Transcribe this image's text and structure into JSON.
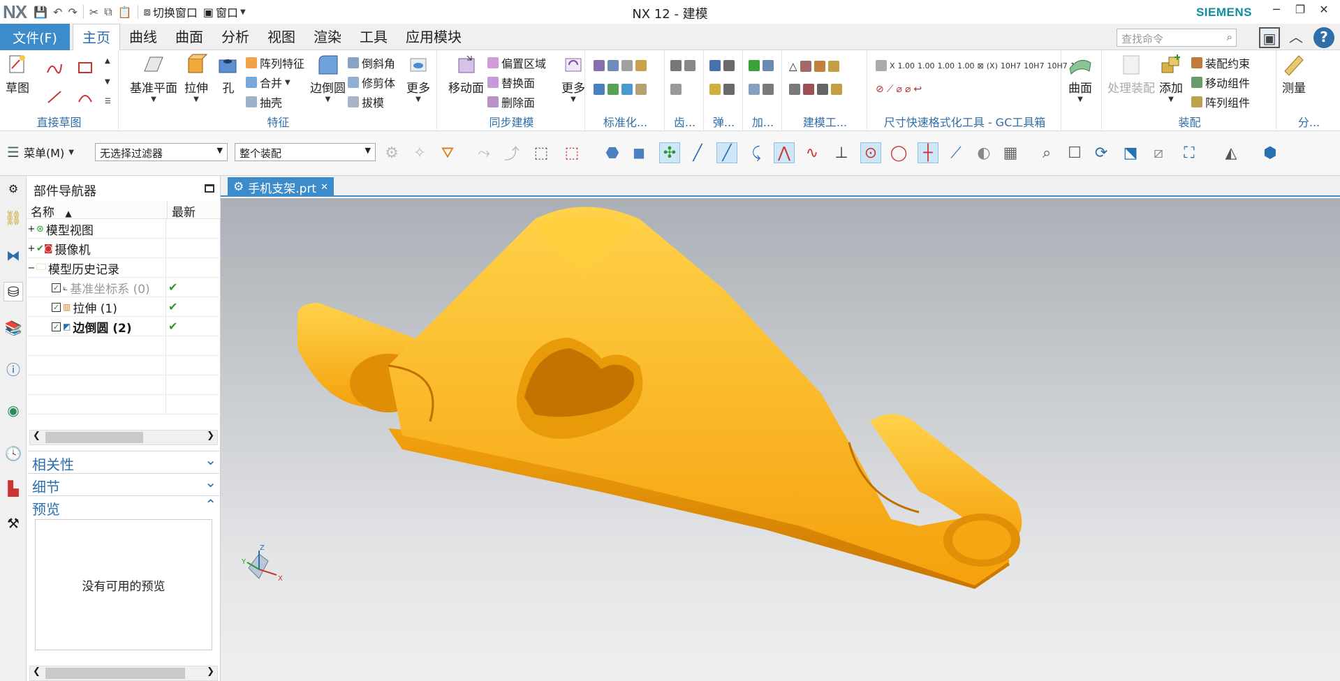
{
  "window": {
    "app_logo": "NX",
    "title": "NX 12 - 建模",
    "brand": "SIEMENS",
    "switch_window": "切换窗口",
    "window_menu": "窗口"
  },
  "menubar": {
    "file": "文件(F)",
    "tabs": [
      "主页",
      "曲线",
      "曲面",
      "分析",
      "视图",
      "渲染",
      "工具",
      "应用模块"
    ],
    "search_placeholder": "查找命令"
  },
  "ribbon": {
    "direct_sketch": {
      "label": "直接草图",
      "sketch": "草图"
    },
    "feature": {
      "label": "特征",
      "datum_plane": "基准平面",
      "extrude": "拉伸",
      "hole": "孔",
      "pattern_feature": "阵列特征",
      "unite": "合并",
      "shell": "抽壳",
      "edge_blend": "边倒圆",
      "chamfer": "倒斜角",
      "trim_body": "修剪体",
      "draft": "拔模",
      "more": "更多"
    },
    "sync": {
      "label": "同步建模",
      "move_face": "移动面",
      "offset_region": "偏置区域",
      "replace_face": "替换面",
      "delete_face": "删除面",
      "more": "更多"
    },
    "standard": {
      "label": "标准化..."
    },
    "gear": {
      "label": "齿..."
    },
    "spring": {
      "label": "弹..."
    },
    "add": {
      "label": "加..."
    },
    "modeling_tools": {
      "label": "建模工..."
    },
    "gc_toolbox": {
      "label": "尺寸快速格式化工具 - GC工具箱"
    },
    "surface": {
      "btn": "曲面"
    },
    "assembly": {
      "label": "装配",
      "process_assembly": "处理装配",
      "add": "添加",
      "assembly_constraint": "装配约束",
      "move_component": "移动组件",
      "pattern_component": "阵列组件"
    },
    "analysis": {
      "label": "分...",
      "measure": "测量"
    }
  },
  "toolbar": {
    "menu_label": "菜单(M)",
    "filter": "无选择过滤器",
    "scope": "整个装配"
  },
  "navigator": {
    "title": "部件导航器",
    "col_name": "名称",
    "col_latest": "最新",
    "rows": [
      {
        "label": "模型视图",
        "latest": ""
      },
      {
        "label": "摄像机",
        "latest": ""
      },
      {
        "label": "模型历史记录",
        "latest": ""
      },
      {
        "label": "基准坐标系 (0)",
        "latest": "✔"
      },
      {
        "label": "拉伸 (1)",
        "latest": "✔"
      },
      {
        "label": "边倒圆 (2)",
        "latest": "✔"
      }
    ],
    "sections": {
      "dependencies": "相关性",
      "details": "细节",
      "preview": "预览"
    },
    "preview_empty": "没有可用的预览"
  },
  "document": {
    "tab": "手机支架.prt"
  },
  "triad": {
    "x": "X",
    "y": "Y",
    "z": "Z"
  },
  "colors": {
    "accent": "#3c8ccc",
    "model": "#f5a10c",
    "brand": "#0d8fa0"
  }
}
